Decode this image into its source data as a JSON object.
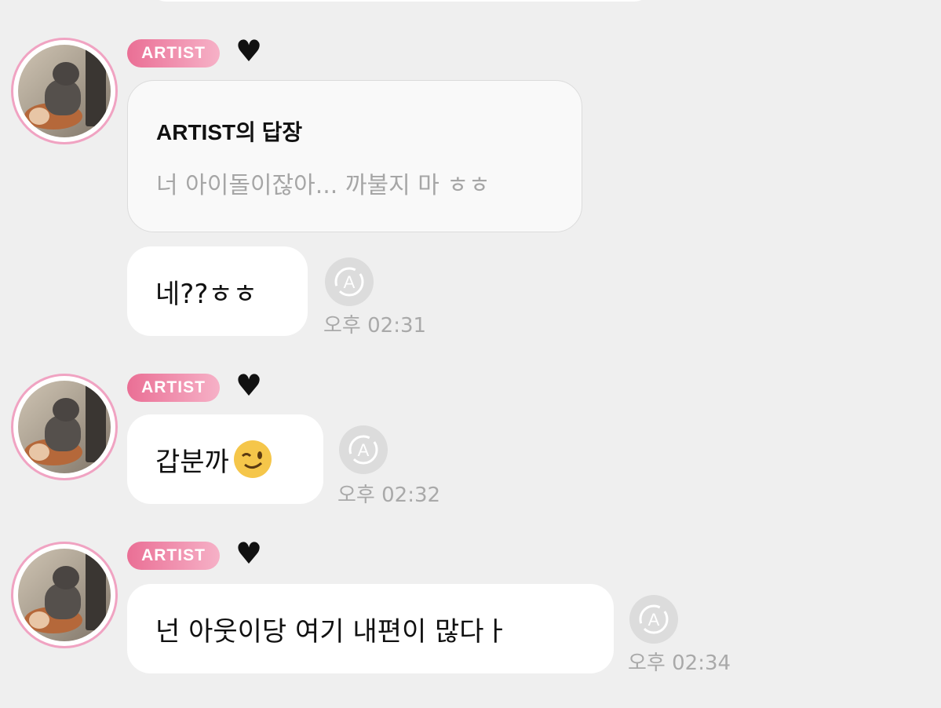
{
  "author_badge": "ARTIST",
  "heart_icon": "black-heart-icon",
  "reply": {
    "title": "ARTIST의 답장",
    "quoted_text": "너 아이돌이잖아... 까불지 마 ㅎㅎ"
  },
  "messages": [
    {
      "text": "네??ㅎㅎ",
      "time": "오후 02:31"
    },
    {
      "text": "갑분까",
      "emoji": "winking-face-emoji",
      "time": "오후 02:32"
    },
    {
      "text": "넌 아웃이당 여기 내편이 많다ㅏ",
      "time": "오후 02:34"
    }
  ],
  "icons": {
    "translate": "translate-a-icon",
    "avatar": "monkey-avatar"
  },
  "colors": {
    "background": "#efefef",
    "badge_start": "#ea6f95",
    "badge_end": "#f6b1c7",
    "avatar_ring": "#f0a3c2"
  }
}
